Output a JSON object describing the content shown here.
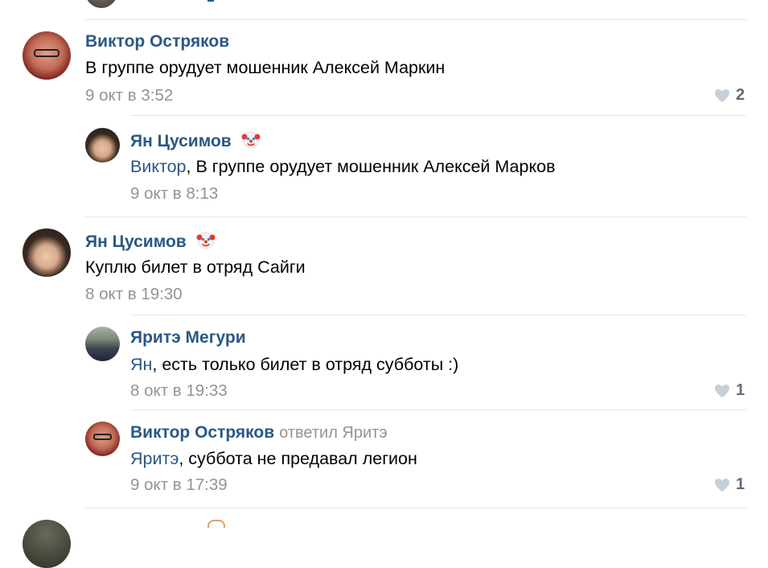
{
  "comments": [
    {
      "author": "Виктор Остряков",
      "text": "В группе орудует мошенник Алексей Маркин",
      "date": "9 окт в 3:52",
      "likes": "2"
    },
    {
      "author": "Ян Цусимов",
      "mention": "Виктор",
      "text": ", В группе орудует мошенник Алексей Марков",
      "date": "9 окт в 8:13"
    },
    {
      "author": "Ян Цусимов",
      "text": "Куплю билет в отряд Сайги",
      "date": "8 окт в 19:30"
    },
    {
      "author": "Яритэ Мегури",
      "mention": "Ян",
      "text": ", есть только билет в отряд субботы :)",
      "date": "8 окт в 19:33",
      "likes": "1"
    },
    {
      "author": "Виктор Остряков",
      "reply_to": "ответил Яритэ",
      "mention": "Яритэ",
      "text": ", суббота не предавал легион",
      "date": "9 окт в 17:39",
      "likes": "1"
    }
  ],
  "colors": {
    "link": "#2a5885",
    "muted": "#939393",
    "separator": "#e7e8ec",
    "like_icon": "#c5d0db"
  },
  "icons": {
    "like": "heart-icon",
    "badge": "clown-face-emoji"
  }
}
